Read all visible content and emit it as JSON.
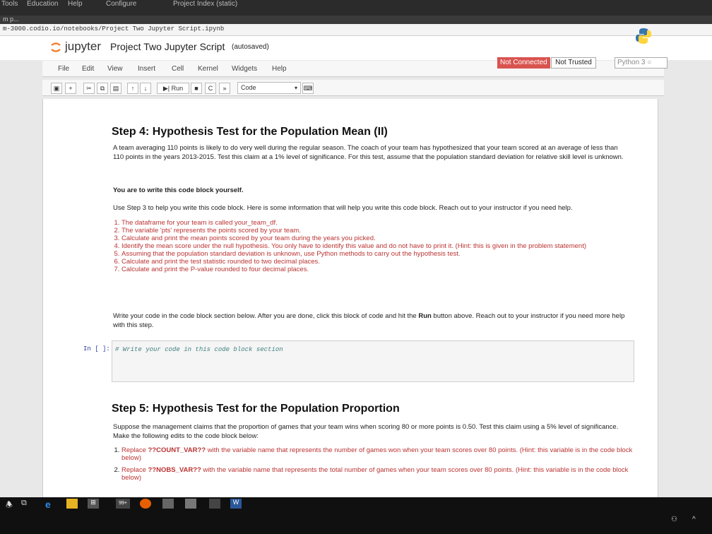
{
  "os_menu": {
    "tools": "Tools",
    "education": "Education",
    "help": "Help",
    "configure": "Configure",
    "project": "Project Index (static)"
  },
  "browser": {
    "url": "m-3000.codio.io/notebooks/Project Two Jupyter Script.ipynb"
  },
  "header": {
    "app": "jupyter",
    "notebook_name": "Project Two Jupyter Script",
    "autosaved": "(autosaved)"
  },
  "menus": [
    "File",
    "Edit",
    "View",
    "Insert",
    "Cell",
    "Kernel",
    "Widgets",
    "Help"
  ],
  "status": {
    "not_connected": "Not Connected",
    "not_trusted": "Not Trusted",
    "kernel": "Python 3"
  },
  "toolbar": {
    "run": "Run",
    "cell_type": "Code"
  },
  "step4": {
    "title": "Step 4: Hypothesis Test for the Population Mean (II)",
    "intro": "A team averaging 110 points is likely to do very well during the regular season. The coach of your team has hypothesized that your team scored at an average of less than 110 points in the years 2013-2015. Test this claim at a 1% level of significance. For this test, assume that the population standard deviation for relative skill level is unknown.",
    "instruction": "You are to write this code block yourself.",
    "help": "Use Step 3 to help you write this code block. Here is some information that will help you write this code block. Reach out to your instructor if you need help.",
    "items": [
      "The dataframe for your team is called your_team_df.",
      "The variable 'pts' represents the points scored by your team.",
      "Calculate and print the mean points scored by your team during the years you picked.",
      "Identify the mean score under the null hypothesis. You only have to identify this value and do not have to print it. (Hint: this is given in the problem statement)",
      "Assuming that the population standard deviation is unknown, use Python methods to carry out the hypothesis test.",
      "Calculate and print the test statistic rounded to two decimal places.",
      "Calculate and print the P-value rounded to four decimal places."
    ],
    "write_code_pre": "Write your code in the code block section below. After you are done, click this block of code and hit the ",
    "write_code_run": "Run",
    "write_code_post": " button above. Reach out to your instructor if you need more help with this step.",
    "prompt": "In [ ]:",
    "code": "# Write your code in this code block section"
  },
  "step5": {
    "title": "Step 5: Hypothesis Test for the Population Proportion",
    "intro": "Suppose the management claims that the proportion of games that your team wins when scoring 80 or more points is 0.50. Test this claim using a 5% level of significance. Make the following edits to the code block below:",
    "items": [
      {
        "pre": "Replace ",
        "code": "??COUNT_VAR??",
        "post": " with the variable name that represents the number of games won when your team scores over 80 points. (Hint: this variable is in the code block below)"
      },
      {
        "pre": "Replace ",
        "code": "??NOBS_VAR??",
        "post": " with the variable name that represents the total number of games when your team scores over 80 points. (Hint: this variable is in the code block below)"
      }
    ]
  },
  "taskbar": {
    "badge": "99+"
  }
}
